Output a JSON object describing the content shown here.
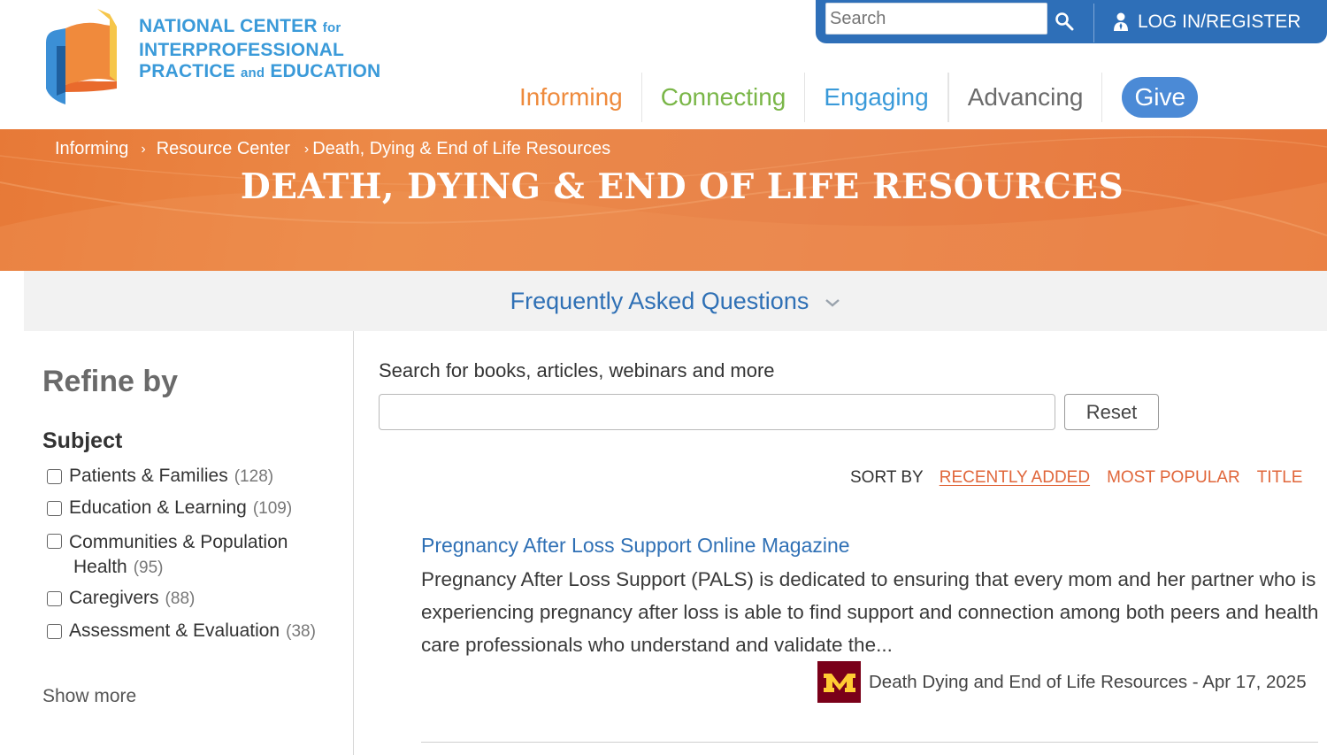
{
  "header": {
    "logo_line1": "NATIONAL CENTER",
    "logo_line1_small": "for",
    "logo_line2": "INTERPROFESSIONAL",
    "logo_line3a": "PRACTICE",
    "logo_line3_small": "and",
    "logo_line3b": "EDUCATION",
    "search_placeholder": "Search",
    "login_label": "LOG IN/REGISTER",
    "nav": [
      {
        "label": "Informing",
        "color": "#ee8a3c"
      },
      {
        "label": "Connecting",
        "color": "#7ab648"
      },
      {
        "label": "Engaging",
        "color": "#3a9ad9"
      },
      {
        "label": "Advancing",
        "color": "#6b6b6b"
      }
    ],
    "give_label": "Give"
  },
  "hero": {
    "breadcrumb": [
      "Informing",
      "Resource Center",
      "Death, Dying & End of Life Resources"
    ],
    "separator": "›",
    "title": "DEATH, DYING & END OF LIFE RESOURCES"
  },
  "faq": {
    "label": "Frequently Asked Questions"
  },
  "sidebar": {
    "refine_title": "Refine by",
    "subject_title": "Subject",
    "facets": [
      {
        "label": "Patients & Families",
        "count": "(128)"
      },
      {
        "label": "Education & Learning",
        "count": "(109)"
      },
      {
        "label": "Communities & Population",
        "label2": "Health",
        "count": "(95)"
      },
      {
        "label": "Caregivers",
        "count": "(88)"
      },
      {
        "label": "Assessment & Evaluation",
        "count": "(38)"
      }
    ],
    "show_more": "Show more"
  },
  "main": {
    "search_label": "Search for books, articles, webinars and more",
    "search_value": "",
    "reset_label": "Reset",
    "sort_by": "SORT BY",
    "sort_options": [
      "RECENTLY ADDED",
      "MOST POPULAR",
      "TITLE"
    ],
    "active_sort": "RECENTLY ADDED",
    "results": [
      {
        "title": "Pregnancy After Loss Support Online Magazine",
        "description": "Pregnancy After Loss Support (PALS) is dedicated to ensuring that every mom and her partner who is experiencing pregnancy after loss is able to find support and connection among both peers and health care professionals who understand and validate the...",
        "source": "Death Dying and End of Life Resources",
        "date_sep": " - ",
        "date": "Apr 17, 2025",
        "source_logo": "university-m-logo"
      }
    ]
  },
  "colors": {
    "brand_blue": "#2e6fb8",
    "link_blue": "#2f70b5",
    "hero_orange": "#e77937",
    "sort_orange": "#e0663a",
    "umn_maroon": "#7a0019",
    "umn_gold": "#ffcc33"
  }
}
